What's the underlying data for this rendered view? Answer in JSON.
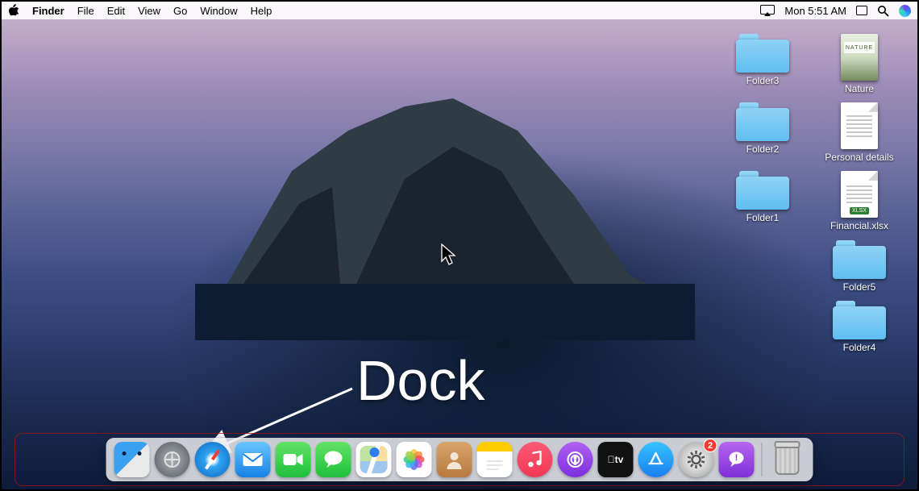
{
  "menubar": {
    "app": "Finder",
    "items": [
      "File",
      "Edit",
      "View",
      "Go",
      "Window",
      "Help"
    ],
    "clock": "Mon 5:51 AM"
  },
  "desktop_icons": [
    {
      "kind": "folder",
      "label": "Folder3"
    },
    {
      "kind": "photo",
      "label": "Nature",
      "banner": "NATURE"
    },
    {
      "kind": "folder",
      "label": "Folder2"
    },
    {
      "kind": "doc",
      "label": "Personal details"
    },
    {
      "kind": "folder",
      "label": "Folder1"
    },
    {
      "kind": "xlsx",
      "label": "Financial.xlsx",
      "tag": "XLSX"
    },
    {
      "kind": "blank",
      "label": ""
    },
    {
      "kind": "folder",
      "label": "Folder5"
    },
    {
      "kind": "blank",
      "label": ""
    },
    {
      "kind": "folder",
      "label": "Folder4"
    }
  ],
  "annotation": {
    "text": "Dock"
  },
  "dock": {
    "apps": [
      {
        "id": "finder",
        "name": "Finder"
      },
      {
        "id": "launchpad",
        "name": "Launchpad"
      },
      {
        "id": "safari",
        "name": "Safari"
      },
      {
        "id": "mail",
        "name": "Mail"
      },
      {
        "id": "facetime",
        "name": "FaceTime"
      },
      {
        "id": "messages",
        "name": "Messages"
      },
      {
        "id": "maps",
        "name": "Maps"
      },
      {
        "id": "photos",
        "name": "Photos"
      },
      {
        "id": "contacts",
        "name": "Contacts"
      },
      {
        "id": "notes",
        "name": "Notes"
      },
      {
        "id": "music",
        "name": "Music"
      },
      {
        "id": "podcasts",
        "name": "Podcasts"
      },
      {
        "id": "tv",
        "name": "TV"
      },
      {
        "id": "appstore",
        "name": "App Store"
      },
      {
        "id": "settings",
        "name": "System Preferences",
        "badge": "2"
      },
      {
        "id": "feedback",
        "name": "Feedback Assistant"
      }
    ],
    "trash": {
      "name": "Trash"
    }
  }
}
